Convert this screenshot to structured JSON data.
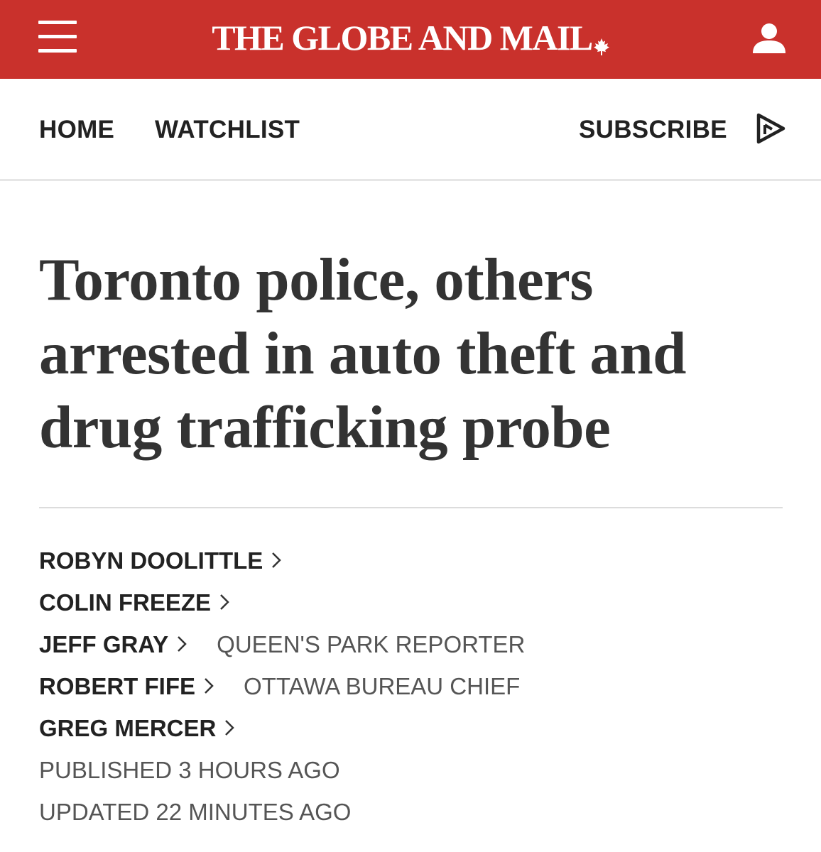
{
  "header": {
    "logo_text": "THE GLOBE AND MAIL",
    "logo_mark": "maple-leaf-icon",
    "menu_icon": "hamburger-menu-icon",
    "account_icon": "user-account-icon",
    "brand_color": "#c9312c"
  },
  "nav": {
    "home_label": "HOME",
    "watchlist_label": "WATCHLIST",
    "subscribe_label": "SUBSCRIBE",
    "audio_icon": "play-audio-icon"
  },
  "article": {
    "headline": "Toronto police, others arrested in auto theft and drug trafficking probe",
    "authors": [
      {
        "name": "ROBYN DOOLITTLE",
        "role": ""
      },
      {
        "name": "COLIN FREEZE",
        "role": ""
      },
      {
        "name": "JEFF GRAY",
        "role": "QUEEN'S PARK REPORTER"
      },
      {
        "name": "ROBERT FIFE",
        "role": "OTTAWA BUREAU CHIEF"
      },
      {
        "name": "GREG MERCER",
        "role": ""
      }
    ],
    "published": "PUBLISHED 3 HOURS AGO",
    "updated": "UPDATED 22 MINUTES AGO"
  }
}
